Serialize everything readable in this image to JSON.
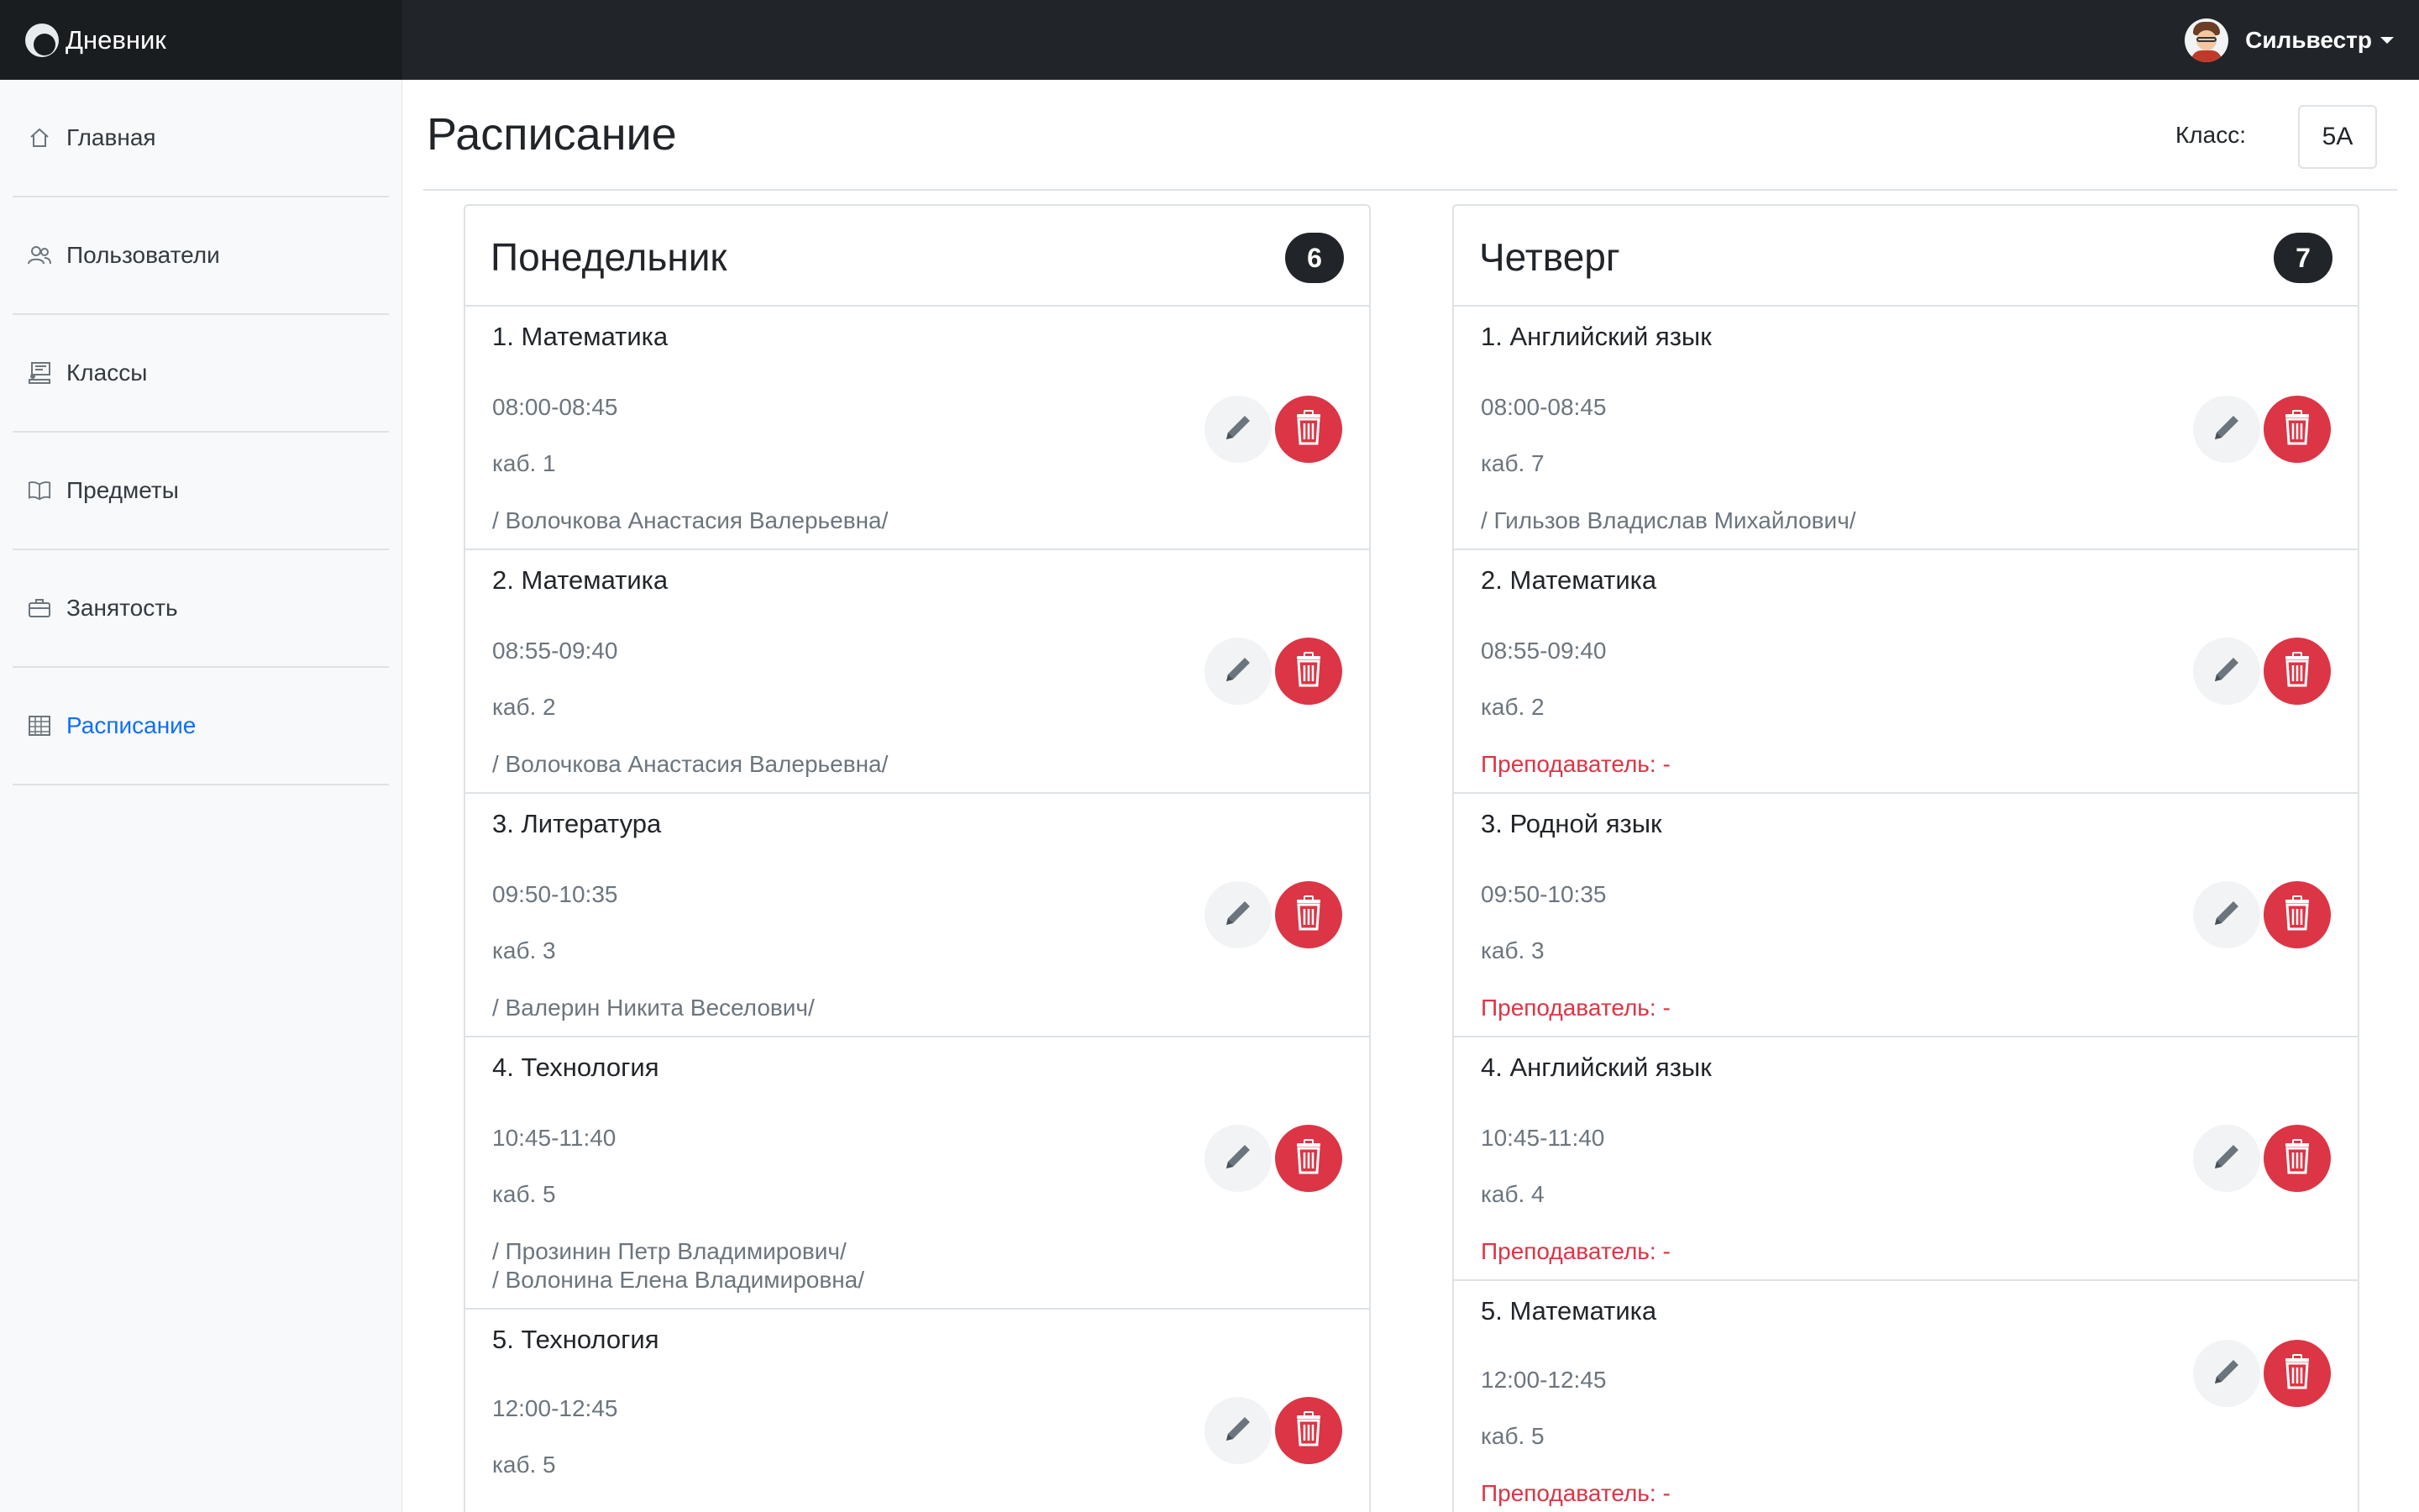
{
  "app": {
    "title": "Дневник",
    "logo_icon": "app-logo-icon"
  },
  "user": {
    "name": "Сильвестр",
    "avatar_icon": "avatar-icon"
  },
  "sidebar": {
    "items": [
      {
        "label": "Главная",
        "icon": "home-icon",
        "active": false
      },
      {
        "label": "Пользователи",
        "icon": "users-icon",
        "active": false
      },
      {
        "label": "Классы",
        "icon": "classes-icon",
        "active": false
      },
      {
        "label": "Предметы",
        "icon": "book-icon",
        "active": false
      },
      {
        "label": "Занятость",
        "icon": "briefcase-icon",
        "active": false
      },
      {
        "label": "Расписание",
        "icon": "calendar-table-icon",
        "active": true
      }
    ]
  },
  "page": {
    "title": "Расписание",
    "class_label": "Класс:",
    "class_value": "5А"
  },
  "colors": {
    "accent": "#0d6efd",
    "danger": "#dc3545",
    "topbar": "#212529",
    "muted": "#6c757d"
  },
  "days": [
    {
      "name": "Понедельник",
      "count": "6",
      "lessons": [
        {
          "title": "1. Математика",
          "time": "08:00-08:45",
          "room": "каб. 1",
          "teacher": "/ Волочкова Анастасия Валерьевна/",
          "missing": false
        },
        {
          "title": "2. Математика",
          "time": "08:55-09:40",
          "room": "каб. 2",
          "teacher": "/ Волочкова Анастасия Валерьевна/",
          "missing": false
        },
        {
          "title": "3. Литература",
          "time": "09:50-10:35",
          "room": "каб. 3",
          "teacher": "/ Валерин Никита Веселович/",
          "missing": false
        },
        {
          "title": "4. Технология",
          "time": "10:45-11:40",
          "room": "каб. 5",
          "teacher": "/ Прозинин Петр Владимирович/",
          "teacher2": "/ Волонина Елена Владимировна/",
          "missing": false
        },
        {
          "title": "5. Технология",
          "time": "12:00-12:45",
          "room": "каб. 5",
          "teacher": "",
          "missing": false
        }
      ]
    },
    {
      "name": "Четверг",
      "count": "7",
      "lessons": [
        {
          "title": "1. Английский язык",
          "time": "08:00-08:45",
          "room": "каб. 7",
          "teacher": "/ Гильзов Владислав Михайлович/",
          "missing": false
        },
        {
          "title": "2. Математика",
          "time": "08:55-09:40",
          "room": "каб. 2",
          "teacher": "Преподаватель: -",
          "missing": true
        },
        {
          "title": "3. Родной язык",
          "time": "09:50-10:35",
          "room": "каб. 3",
          "teacher": "Преподаватель: -",
          "missing": true
        },
        {
          "title": "4. Английский язык",
          "time": "10:45-11:40",
          "room": "каб. 4",
          "teacher": "Преподаватель: -",
          "missing": true
        },
        {
          "title": "5. Математика",
          "time": "12:00-12:45",
          "room": "каб. 5",
          "teacher": "Преподаватель: -",
          "missing": true
        }
      ]
    }
  ]
}
